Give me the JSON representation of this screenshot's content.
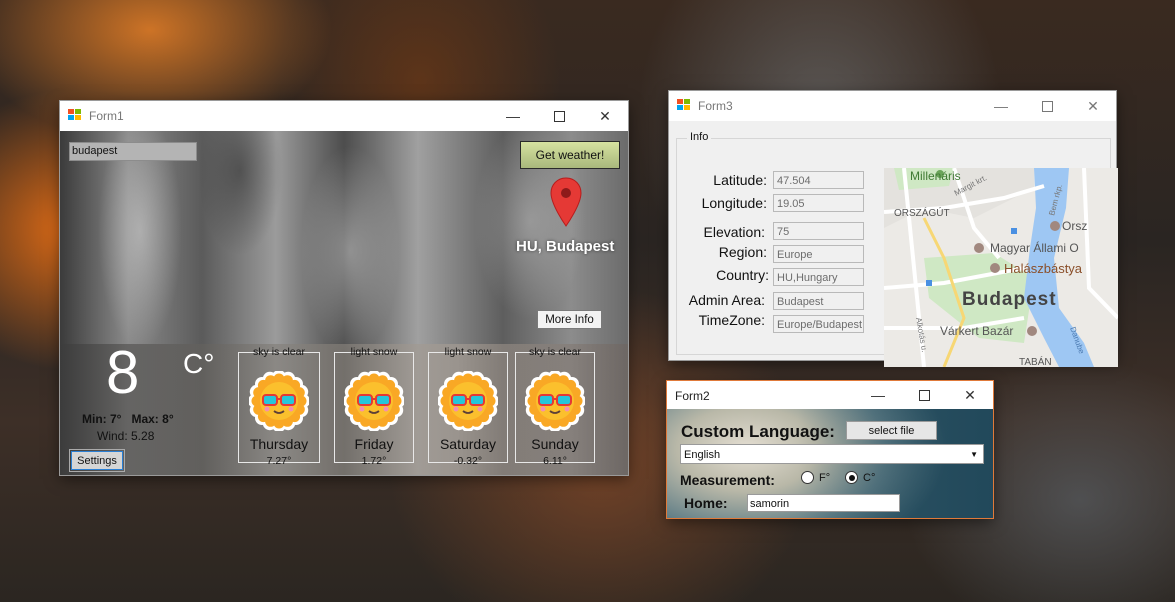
{
  "form1": {
    "title": "Form1",
    "search_value": "budapest",
    "get_weather_label": "Get weather!",
    "location_label": "HU, Budapest",
    "more_info_label": "More Info",
    "current_temp": "8",
    "temp_unit": "C°",
    "min_max": "Min: 7°   Max: 8°",
    "wind": "Wind: 5.28",
    "settings_label": "Settings",
    "forecast": [
      {
        "condition": "sky is clear",
        "day": "Thursday",
        "temp": "7.27°"
      },
      {
        "condition": "light snow",
        "day": "Friday",
        "temp": "1.72°"
      },
      {
        "condition": "light snow",
        "day": "Saturday",
        "temp": "-0.32°"
      },
      {
        "condition": "sky is clear",
        "day": "Sunday",
        "temp": "6.11°"
      }
    ]
  },
  "form3": {
    "title": "Form3",
    "group_title": "Info",
    "fields": {
      "latitude": {
        "label": "Latitude:",
        "value": "47.504"
      },
      "longitude": {
        "label": "Longitude:",
        "value": "19.05"
      },
      "elevation": {
        "label": "Elevation:",
        "value": "75"
      },
      "region": {
        "label": "Region:",
        "value": "Europe"
      },
      "country": {
        "label": "Country:",
        "value": "HU,Hungary"
      },
      "admin_area": {
        "label": "Admin Area:",
        "value": "Budapest"
      },
      "timezone": {
        "label": "TimeZone:",
        "value": "Europe/Budapest"
      }
    },
    "map_labels": {
      "millenaris": "Millenáris",
      "margit": "Margit krt.",
      "bem": "Bem rkp.",
      "orszagut": "ORSZÁGÚT",
      "orsz": "Orsz",
      "magyar": "Magyar Állami O",
      "halaszbastya": "Halászbástya",
      "budapest": "Budapest",
      "varkert": "Várkert Bazár",
      "alkotas": "Alkotás u.",
      "danube": "Danube",
      "taban": "TABÁN"
    }
  },
  "form2": {
    "title": "Form2",
    "custom_language_label": "Custom Language:",
    "select_file_label": "select file",
    "language_value": "English",
    "measurement_label": "Measurement:",
    "radio_f": "F°",
    "radio_c": "C°",
    "home_label": "Home:",
    "home_value": "samorin"
  },
  "icons": {
    "app": "winforms-app-icon",
    "minimize": "minimize-icon",
    "maximize": "maximize-icon",
    "close": "close-icon",
    "pin": "map-pin-icon",
    "sun": "sun-sunglasses-icon"
  },
  "colors": {
    "pin_red": "#e53935",
    "form2_border": "#e07a3a",
    "map_water": "#9ec7f3",
    "map_park": "#cfe8c4"
  }
}
